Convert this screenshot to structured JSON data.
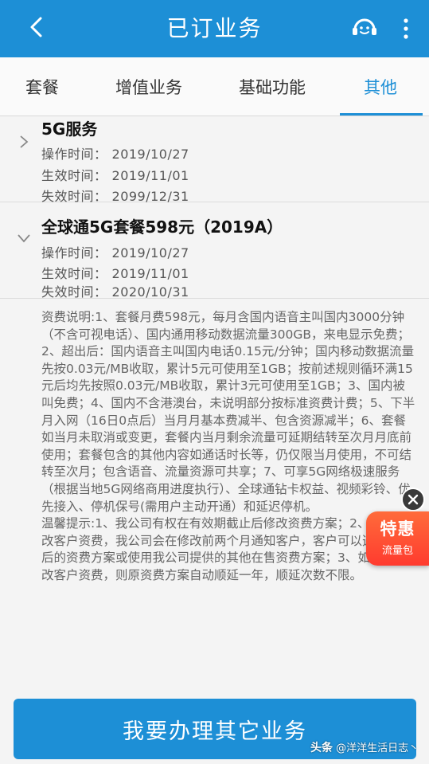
{
  "header": {
    "title": "已订业务"
  },
  "tabs": [
    {
      "label": "套餐"
    },
    {
      "label": "增值业务"
    },
    {
      "label": "基础功能"
    },
    {
      "label": "其他",
      "active": true
    }
  ],
  "items": [
    {
      "title": "5G服务",
      "expanded": false,
      "rows": [
        {
          "k": "操作时间：",
          "v": "2019/10/27"
        },
        {
          "k": "生效时间：",
          "v": "2019/11/01"
        },
        {
          "k": "失效时间：",
          "v": "2099/12/31"
        }
      ]
    },
    {
      "title": "全球通5G套餐598元（2019A）",
      "expanded": true,
      "rows": [
        {
          "k": "操作时间：",
          "v": "2019/10/27"
        },
        {
          "k": "生效时间：",
          "v": "2019/11/01"
        },
        {
          "k": "失效时间：",
          "v": "2020/10/31"
        }
      ]
    }
  ],
  "detail": {
    "fee_desc": "资费说明:1、套餐月费598元，每月含国内语音主叫国内3000分钟（不含可视电话）、国内通用移动数据流量300GB，来电显示免费；2、超出后：国内语音主叫国内电话0.15元/分钟；国内移动数据流量先按0.03元/MB收取，累计5元可使用至1GB；按前述规则循环满15元后均先按照0.03元/MB收取，累计3元可使用至1GB；3、国内被叫免费；4、国内不含港澳台，未说明部分按标准资费计费；5、下半月入网（16日0点后）当月月基本费减半、包含资源减半；6、套餐如当月未取消或变更，套餐内当月剩余流量可延期结转至次月月底前使用；套餐包含的其他内容如通话时长等，仍仅限当月使用，不可结转至次月；包含语音、流量资源可共享；7、可享5G网络极速服务（根据当地5G网络商用进度执行）、全球通钻卡权益、视频彩铃、优先接入、停机保号(需用户主动开通）和延迟停机。",
    "tips": "温馨提示:1、我公司有权在有效期截止后修改资费方案；2、如需修改客户资费，我公司会在修改前两个月通知客户，客户可以选择修改后的资费方案或使用我公司提供的其他在售资费方案；3、如无需修改客户资费，则原资费方案自动顺延一年，顺延次数不限。"
  },
  "promo": {
    "big": "特惠",
    "small": "流量包"
  },
  "cta": {
    "label": "我要办理其它业务"
  },
  "watermark": {
    "prefix": "头条",
    "text": " @洋洋生活日志丶"
  },
  "colors": {
    "brand": "#1d8fd6",
    "promo": "#ff4a2f"
  }
}
